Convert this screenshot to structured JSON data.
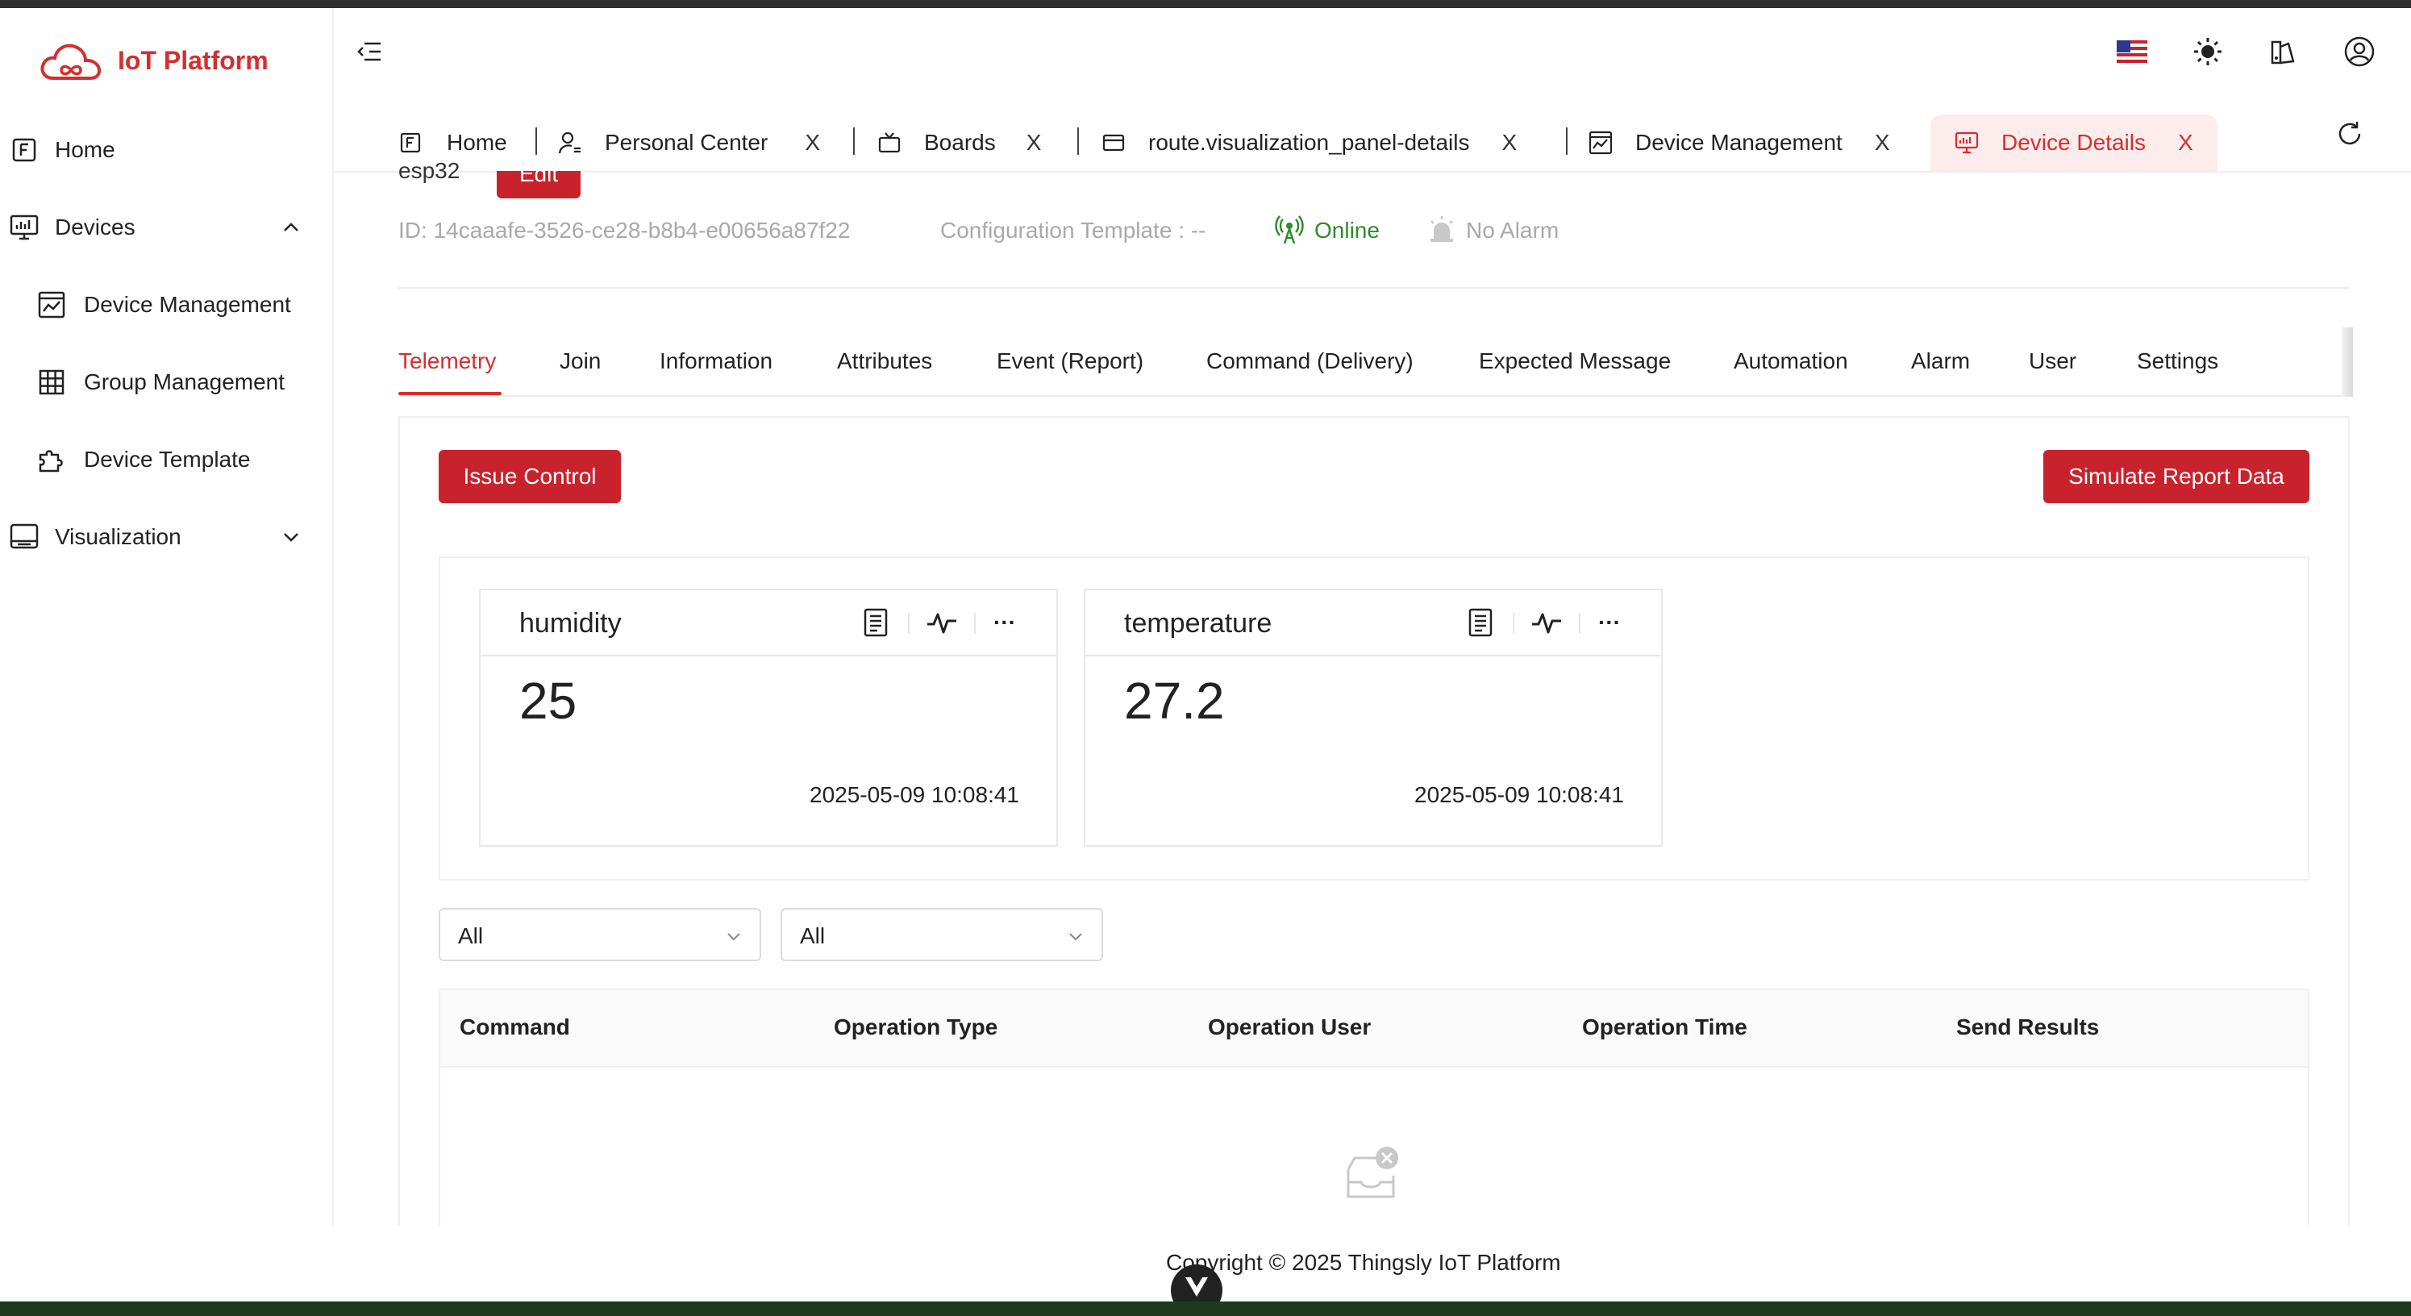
{
  "app": {
    "name": "IoT Platform",
    "brand_color": "#d32f2f"
  },
  "sidebar": {
    "items": [
      {
        "label": "Home",
        "icon": "home-icon"
      },
      {
        "label": "Devices",
        "icon": "monitor-icon",
        "expanded": true
      },
      {
        "label": "Device Management",
        "icon": "chart-window-icon"
      },
      {
        "label": "Group Management",
        "icon": "grid-icon"
      },
      {
        "label": "Device Template",
        "icon": "puzzle-icon"
      },
      {
        "label": "Visualization",
        "icon": "screen-icon",
        "expanded": false
      }
    ]
  },
  "header": {
    "icons": [
      "menu-collapse-icon",
      "us-flag-icon",
      "sun-icon",
      "theme-icon",
      "user-icon"
    ]
  },
  "tabs": [
    {
      "label": "Home",
      "icon": "home-icon",
      "closable": false
    },
    {
      "label": "Personal Center",
      "icon": "person-icon",
      "closable": true
    },
    {
      "label": "Boards",
      "icon": "tv-icon",
      "closable": true
    },
    {
      "label": "route.visualization_panel-details",
      "icon": "card-icon",
      "closable": true
    },
    {
      "label": "Device Management",
      "icon": "chart-window-icon",
      "closable": true
    },
    {
      "label": "Device Details",
      "icon": "monitor-icon",
      "closable": true,
      "active": true
    }
  ],
  "tab_close": "X",
  "device": {
    "name": "esp32",
    "edit_label": "Edit",
    "id_text": "ID:  14caaafe-3526-ce28-b8b4-e00656a87f22",
    "config_text": "Configuration Template :  --",
    "status": "Online",
    "alarm": "No Alarm"
  },
  "subtabs": [
    "Telemetry",
    "Join",
    "Information",
    "Attributes",
    "Event (Report)",
    "Command (Delivery)",
    "Expected Message",
    "Automation",
    "Alarm",
    "User",
    "Settings"
  ],
  "actions": {
    "issue_control": "Issue Control",
    "simulate": "Simulate Report Data"
  },
  "cards": [
    {
      "title": "humidity",
      "value": "25",
      "time": "2025-05-09 10:08:41"
    },
    {
      "title": "temperature",
      "value": "27.2",
      "time": "2025-05-09 10:08:41"
    }
  ],
  "card_more": "···",
  "filters": [
    {
      "value": "All"
    },
    {
      "value": "All"
    }
  ],
  "table": {
    "columns": [
      "Command",
      "Operation Type",
      "Operation User",
      "Operation Time",
      "Send Results"
    ],
    "rows": []
  },
  "footer": {
    "copyright": "Copyright © 2025 Thingsly IoT Platform"
  }
}
